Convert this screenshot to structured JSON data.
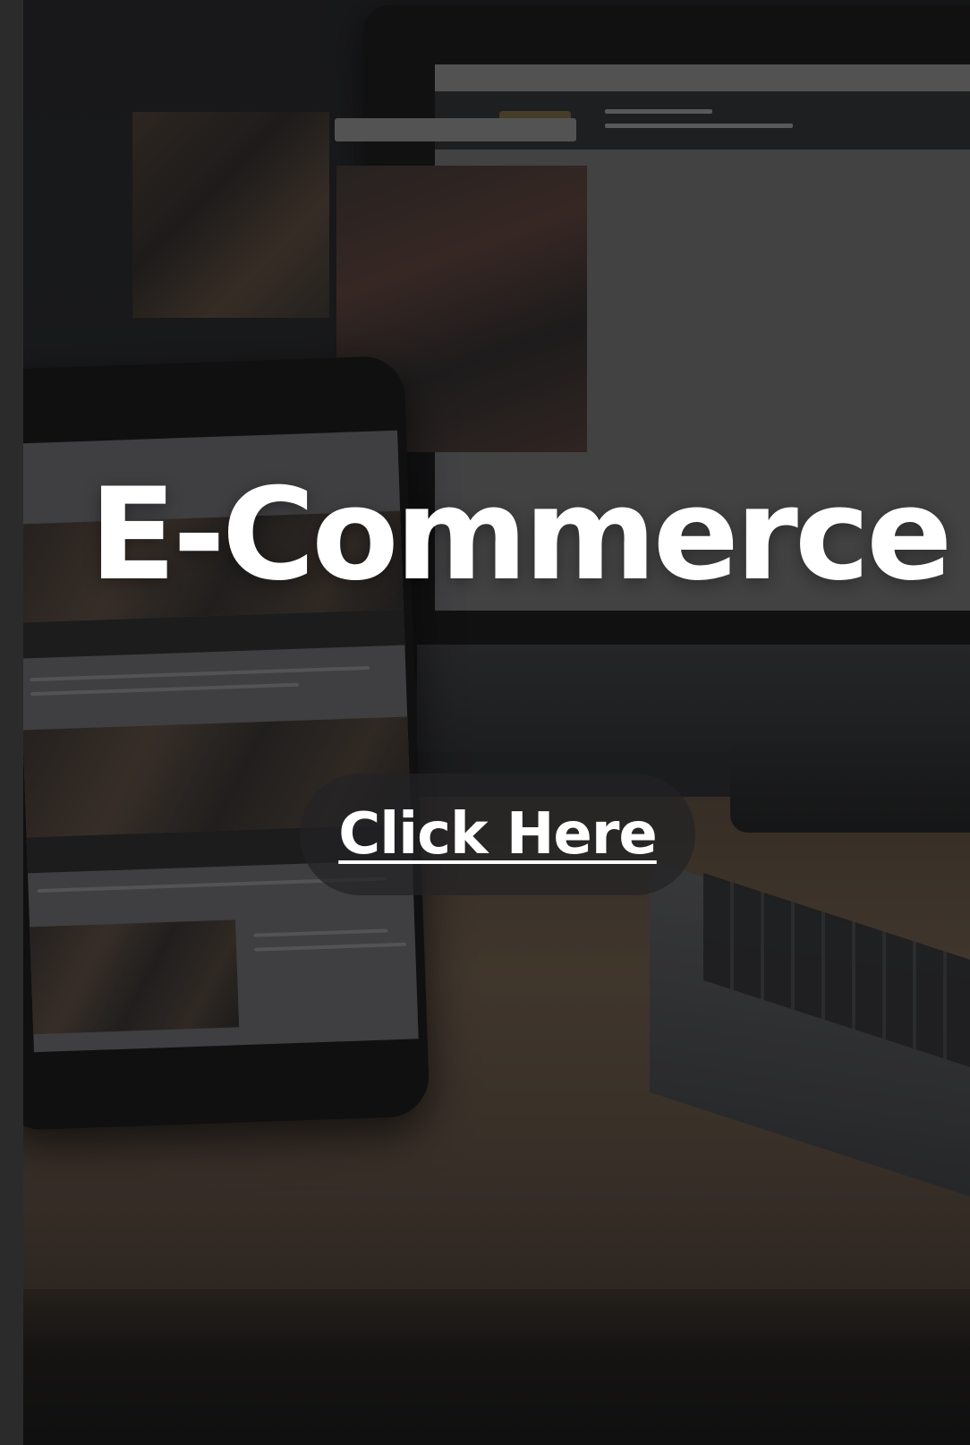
{
  "hero": {
    "title": "E-Commerce",
    "cta_label": "Click Here",
    "background_image": "laptop-phone-monitor-mockup"
  },
  "colors": {
    "strip": "#2b2b2c",
    "title_text": "#ffffff",
    "button_bg": "rgba(35,35,38,0.72)"
  }
}
